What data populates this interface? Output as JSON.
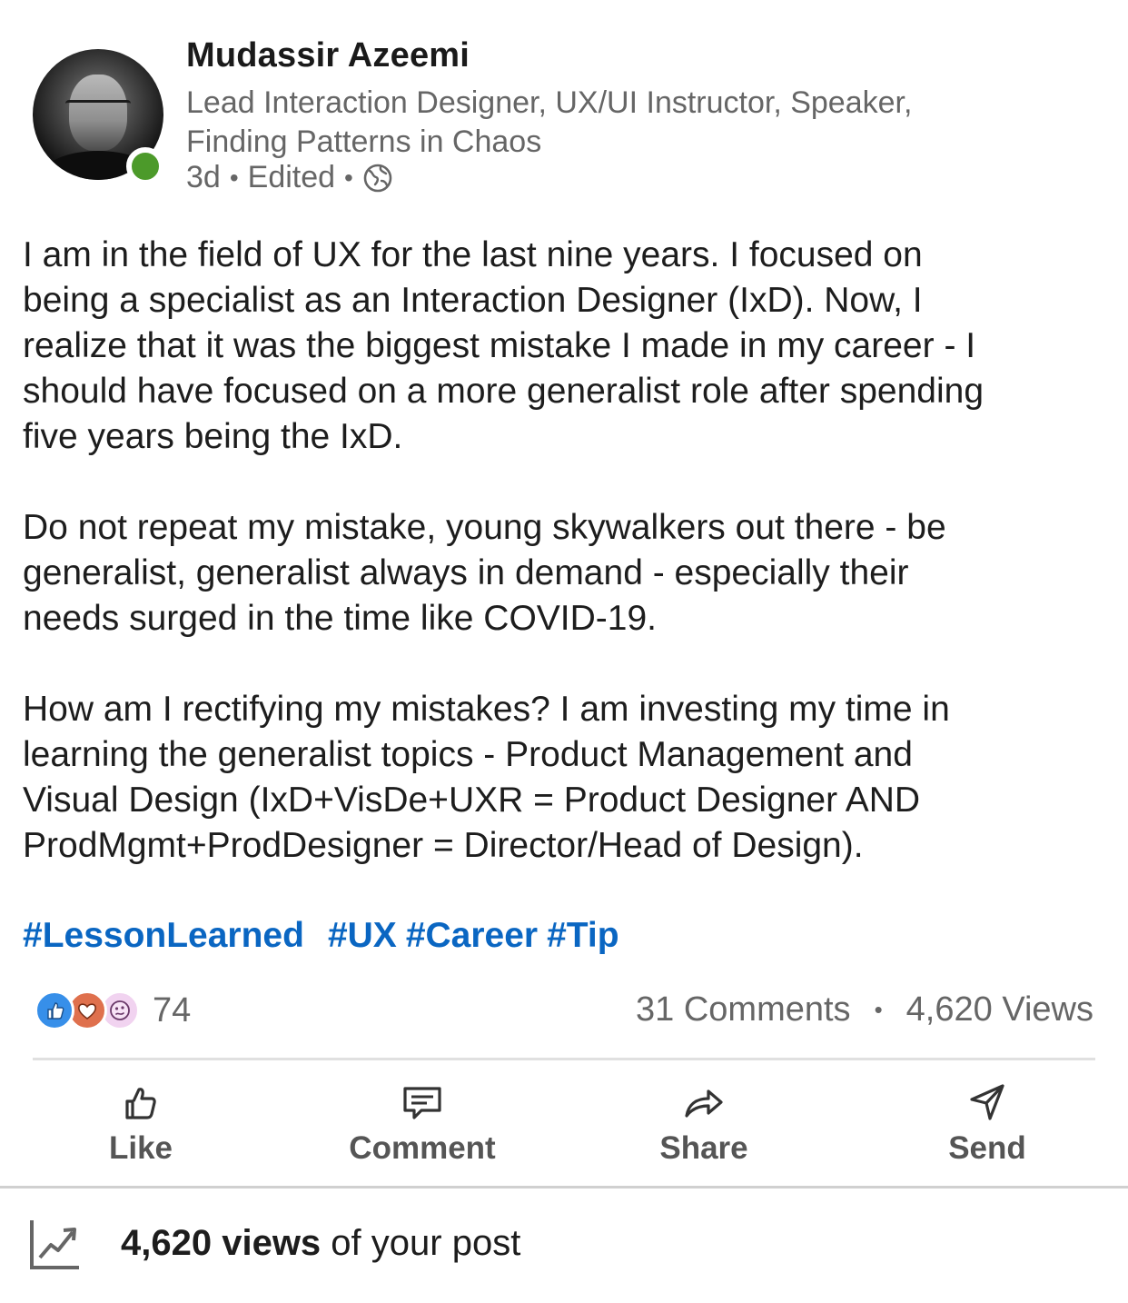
{
  "author": {
    "name": "Mudassir Azeemi",
    "headline_line1": "Lead Interaction Designer, UX/UI Instructor, Speaker,",
    "headline_line2": "Finding Patterns in Chaos",
    "time": "3d",
    "edited": "Edited",
    "visibility_icon": "globe-icon",
    "online_status_color": "#4c9a2a"
  },
  "post": {
    "paragraphs": [
      "I am in the field of UX for the last nine years. I focused on\nbeing a specialist as an Interaction Designer (IxD). Now, I\nrealize that it was the biggest mistake I made in my career - I\nshould have focused on a more generalist role after spending\nfive years being the IxD.",
      "Do not repeat my mistake, young skywalkers out there - be\ngeneralist, generalist always in demand - especially their\nneeds surged in the time like COVID-19.",
      "How am I rectifying my mistakes? I am investing my time in\nlearning the generalist topics - Product Management and\nVisual Design (IxD+VisDe+UXR = Product Designer AND\nProdMgmt+ProdDesigner = Director/Head of Design)."
    ],
    "hashtags": [
      "#LessonLearned",
      "#UX",
      "#Career",
      "#Tip"
    ],
    "hashtag_color": "#0a66c2"
  },
  "social": {
    "reaction_icons": [
      "like-icon",
      "love-icon",
      "curious-icon"
    ],
    "reaction_count": "74",
    "comments": "31 Comments",
    "views": "4,620 Views"
  },
  "actions": {
    "like": "Like",
    "comment": "Comment",
    "share": "Share",
    "send": "Send"
  },
  "footer": {
    "views_bold": "4,620 views",
    "views_suffix": " of your post"
  }
}
